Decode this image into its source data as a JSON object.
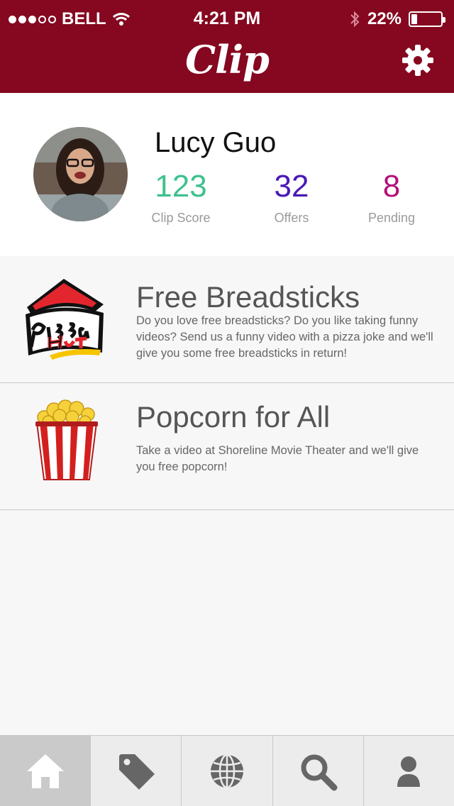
{
  "status_bar": {
    "carrier": "BELL",
    "time": "4:21 PM",
    "battery": "22%"
  },
  "header": {
    "title": "Clip",
    "settings_icon": "gear-icon"
  },
  "profile": {
    "name": "Lucy Guo",
    "stats": [
      {
        "value": "123",
        "label": "Clip Score",
        "color": "#3fc18e"
      },
      {
        "value": "32",
        "label": "Offers",
        "color": "#4a19b7"
      },
      {
        "value": "8",
        "label": "Pending",
        "color": "#b1117a"
      }
    ]
  },
  "offers": [
    {
      "title": "Free Breadsticks",
      "description": "Do you love free breadsticks? Do you like taking funny videos? Send us a funny video with a pizza joke and we'll give you some free breadsticks in return!",
      "logo_text": "Pizza Hut"
    },
    {
      "title": "Popcorn for All",
      "description": "Take a video at Shoreline Movie Theater and we'll give you free popcorn!"
    }
  ],
  "tabs": [
    {
      "icon": "home-icon",
      "active": true
    },
    {
      "icon": "tag-icon",
      "active": false
    },
    {
      "icon": "globe-icon",
      "active": false
    },
    {
      "icon": "search-icon",
      "active": false
    },
    {
      "icon": "person-icon",
      "active": false
    }
  ],
  "colors": {
    "brand": "#850720"
  }
}
